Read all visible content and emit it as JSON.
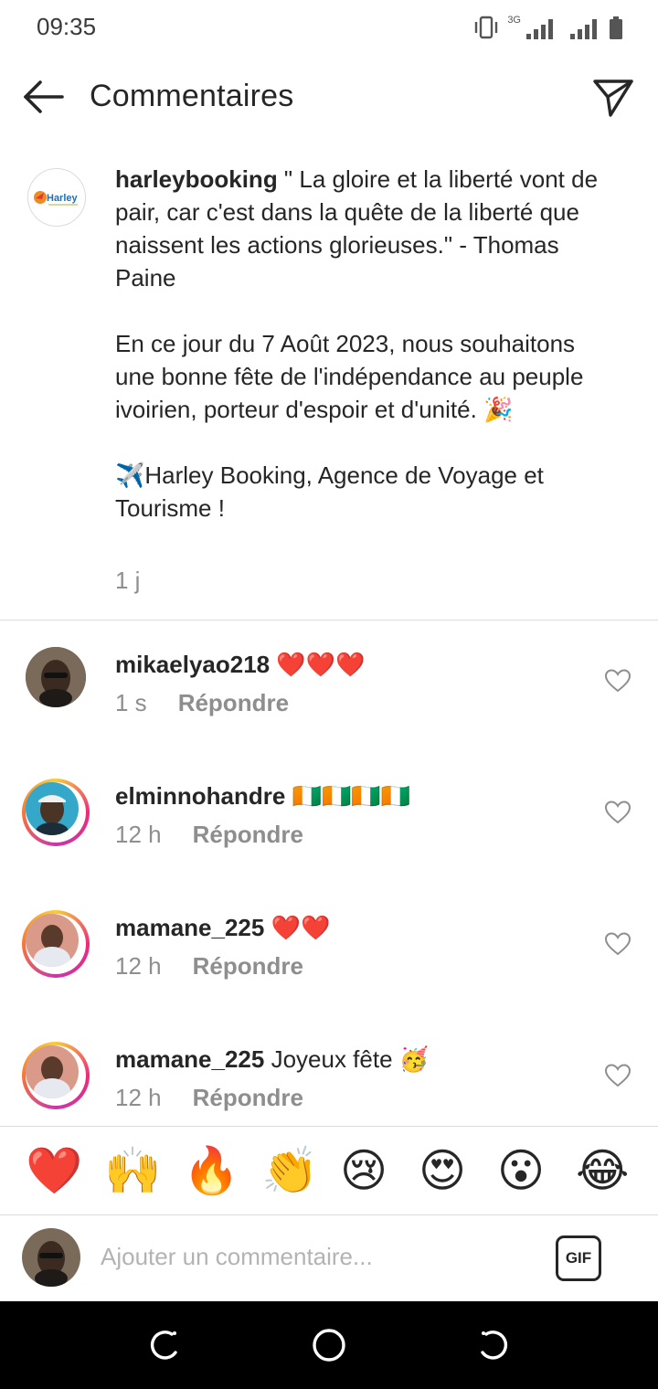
{
  "status_bar": {
    "time": "09:35",
    "network": "3G"
  },
  "header": {
    "title": "Commentaires"
  },
  "caption": {
    "username": "harleybooking",
    "text": " \" La gloire et la liberté vont de pair, car c'est dans la quête de la liberté que naissent les actions glorieuses.\" - Thomas Paine\n\nEn ce jour du 7 Août 2023, nous souhaitons une bonne fête de l'indépendance au peuple ivoirien, porteur d'espoir et d'unité. 🎉\n\n✈️Harley Booking, Agence de Voyage et Tourisme !",
    "time": "1 j",
    "avatar_logo_text": "Harley"
  },
  "comments": [
    {
      "username": "mikaelyao218",
      "text": " ❤️❤️❤️",
      "time": "1 s",
      "reply": "Répondre"
    },
    {
      "username": "elminnohandre",
      "text": " 🇨🇮🇨🇮🇨🇮🇨🇮",
      "time": "12 h",
      "reply": "Répondre"
    },
    {
      "username": "mamane_225",
      "text": " ❤️❤️",
      "time": "12 h",
      "reply": "Répondre"
    },
    {
      "username": "mamane_225",
      "text": " Joyeux fête 🥳",
      "time": "12 h",
      "reply": "Répondre"
    }
  ],
  "emoji_bar": [
    "❤️",
    "🙌",
    "🔥",
    "👏",
    "😢",
    "😍",
    "😮",
    "😂"
  ],
  "input": {
    "placeholder": "Ajouter un commentaire...",
    "gif_label": "GIF"
  },
  "icons": {
    "back": "arrow-left-icon",
    "share": "paper-plane-icon",
    "like": "heart-outline-icon",
    "nav_back": "back-icon",
    "nav_home": "home-icon",
    "nav_recent": "recent-apps-icon"
  }
}
